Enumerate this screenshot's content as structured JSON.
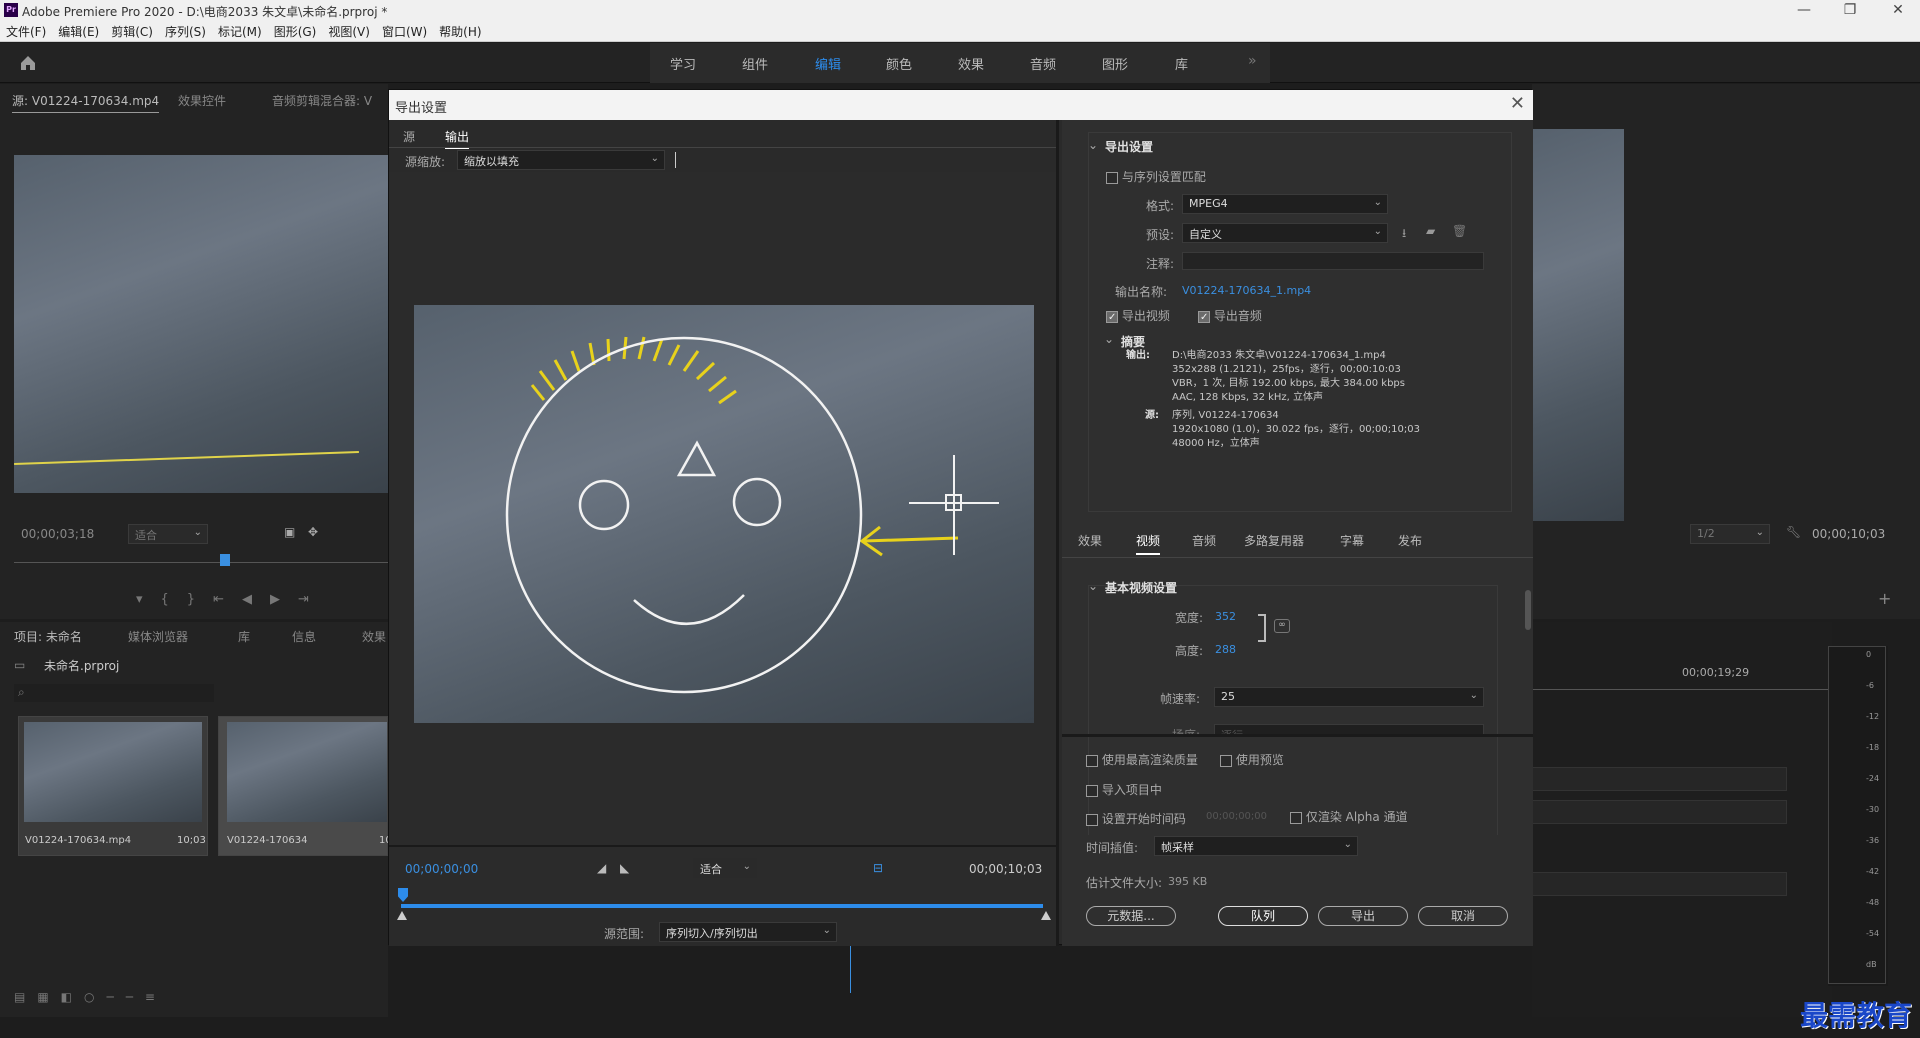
{
  "app": {
    "title": "Adobe Premiere Pro 2020 - D:\\电商2033 朱文卓\\未命名.prproj *"
  },
  "menu": [
    "文件(F)",
    "编辑(E)",
    "剪辑(C)",
    "序列(S)",
    "标记(M)",
    "图形(G)",
    "视图(V)",
    "窗口(W)",
    "帮助(H)"
  ],
  "workspaces": [
    "学习",
    "组件",
    "编辑",
    "颜色",
    "效果",
    "音频",
    "图形",
    "库"
  ],
  "active_workspace": "编辑",
  "source_panel": {
    "tabs": [
      "源: V01224-170634.mp4",
      "效果控件",
      "音频剪辑混合器: V"
    ],
    "timecode": "00;00;03;18",
    "fit": "适合"
  },
  "program_panel": {
    "zoom": "1/2",
    "timecode": "00;00;10;03"
  },
  "project_panel": {
    "tabs": [
      "项目: 未命名",
      "媒体浏览器",
      "库",
      "信息",
      "效果"
    ],
    "project_file": "未命名.prproj",
    "items": [
      {
        "name": "V01224-170634.mp4",
        "duration": "10;03"
      },
      {
        "name": "V01224-170634",
        "duration": "10"
      }
    ]
  },
  "timeline": {
    "timecode": "00;00;19;29"
  },
  "vu_scale": [
    "0",
    "-6",
    "-12",
    "-18",
    "-24",
    "-30",
    "-36",
    "-42",
    "-48",
    "-54",
    "dB"
  ],
  "export_dialog": {
    "title": "导出设置",
    "left_tabs": [
      "源",
      "输出"
    ],
    "active_left_tab": "输出",
    "source_scaling_label": "源缩放:",
    "source_scaling_value": "缩放以填充",
    "current_time": "00;00;00;00",
    "fit": "适合",
    "end_time": "00;00;10;03",
    "source_range_label": "源范围:",
    "source_range_value": "序列切入/序列切出",
    "settings": {
      "section_title": "导出设置",
      "match_sequence": "与序列设置匹配",
      "format_label": "格式:",
      "format_value": "MPEG4",
      "preset_label": "预设:",
      "preset_value": "自定义",
      "comment_label": "注释:",
      "output_name_label": "输出名称:",
      "output_name_value": "V01224-170634_1.mp4",
      "export_video": "导出视频",
      "export_audio": "导出音频",
      "summary_title": "摘要",
      "output_label": "输出:",
      "output_lines": [
        "D:\\电商2033 朱文卓\\V01224-170634_1.mp4",
        "352x288 (1.2121)，25fps，逐行，00;00:10:03",
        "VBR，1 次, 目标 192.00 kbps, 最大 384.00 kbps",
        "AAC, 128 Kbps, 32  kHz, 立体声"
      ],
      "source_label": "源:",
      "source_lines": [
        "序列, V01224-170634",
        "1920x1080 (1.0)，30.022  fps，逐行，00;00;10;03",
        "48000 Hz，立体声"
      ]
    },
    "right_tabs": [
      "效果",
      "视频",
      "音频",
      "多路复用器",
      "字幕",
      "发布"
    ],
    "active_right_tab": "视频",
    "video": {
      "section_title": "基本视频设置",
      "width_label": "宽度:",
      "width_value": "352",
      "height_label": "高度:",
      "height_value": "288",
      "framerate_label": "帧速率:",
      "framerate_value": "25",
      "field_label": "场序:",
      "field_value": "逐行"
    },
    "bottom": {
      "max_render": "使用最高渲染质量",
      "use_previews": "使用预览",
      "import_project": "导入项目中",
      "set_start_tc": "设置开始时间码",
      "start_tc_value": "00;00;00;00",
      "alpha_only": "仅渲染 Alpha 通道",
      "interp_label": "时间插值:",
      "interp_value": "帧采样",
      "filesize_label": "估计文件大小:",
      "filesize_value": "395 KB",
      "metadata_btn": "元数据...",
      "queue_btn": "队列",
      "export_btn": "导出",
      "cancel_btn": "取消"
    }
  },
  "watermark": "最需教育",
  "colors": {
    "accent": "#2d8ceb",
    "drawing": "#f2f2f2",
    "hair": "#e8d21b"
  }
}
